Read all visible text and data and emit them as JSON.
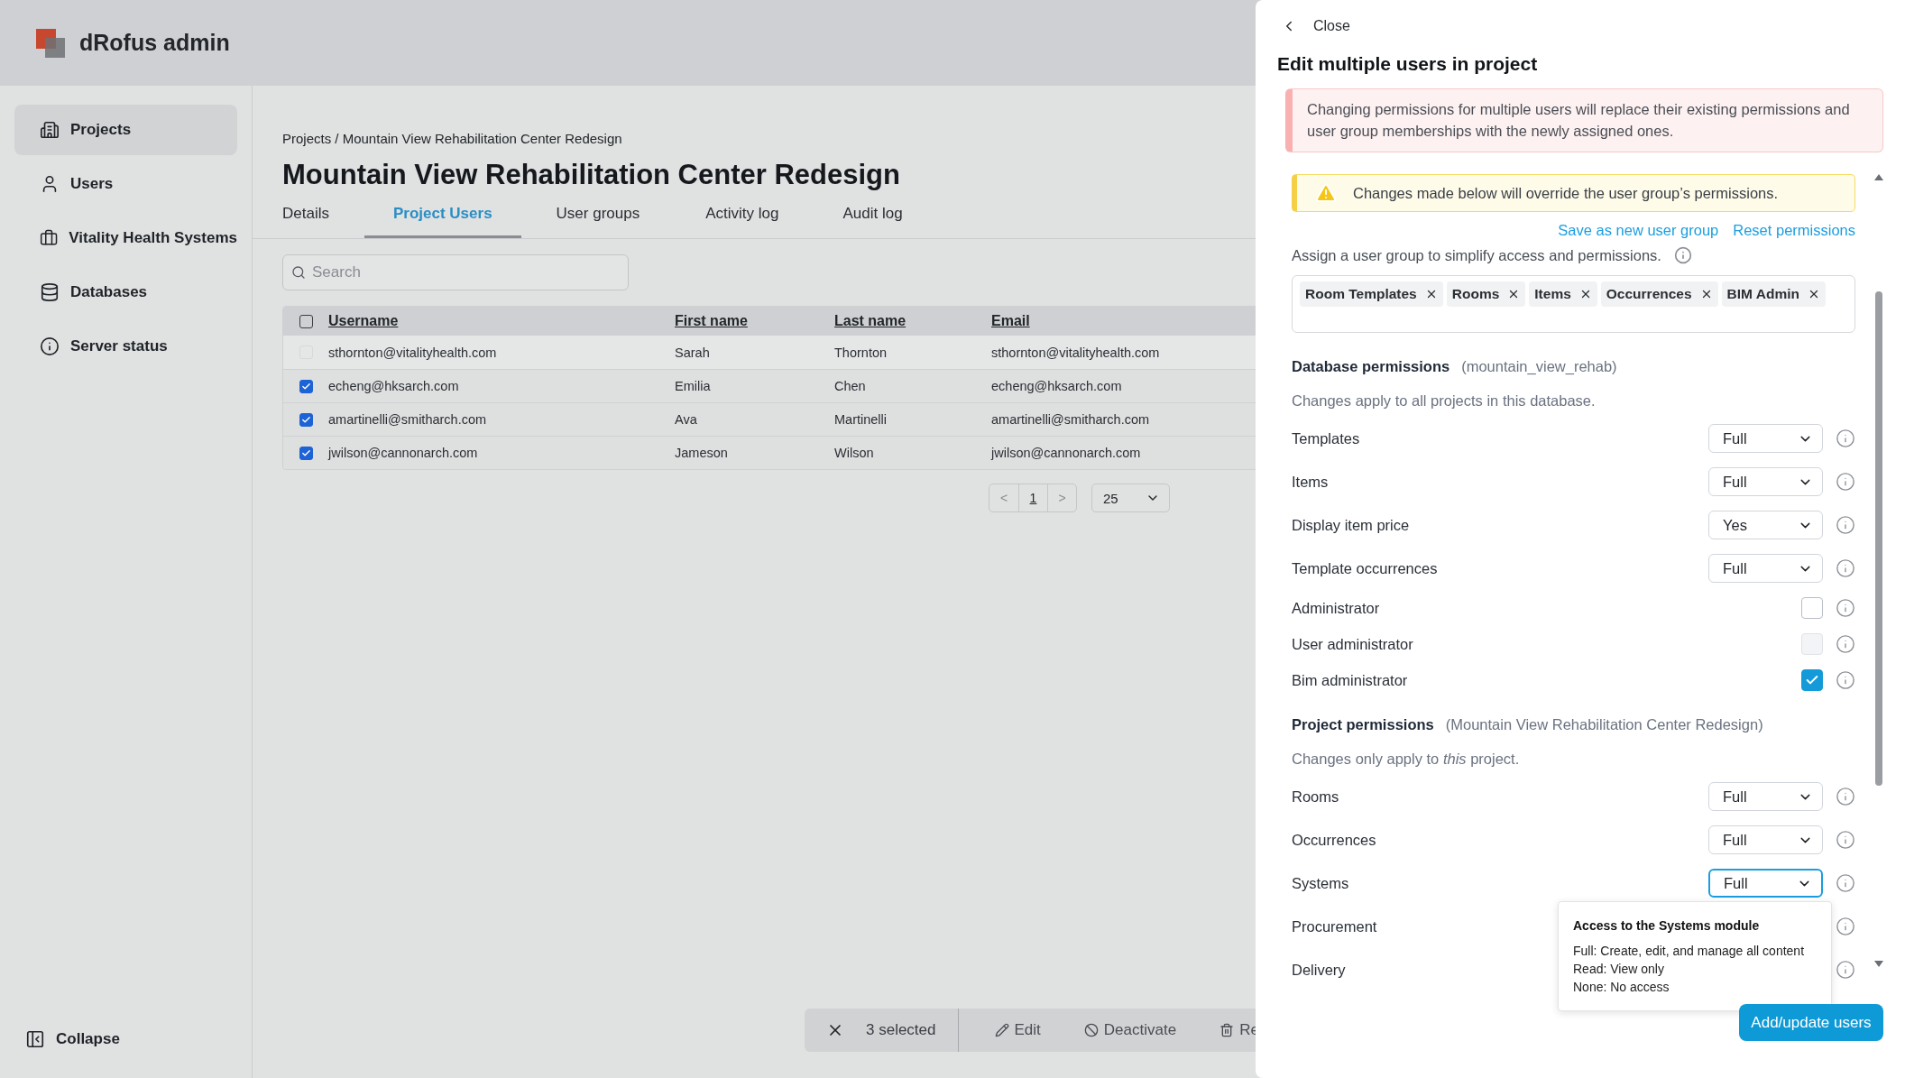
{
  "app": {
    "title": "dRofus admin"
  },
  "sidebar": {
    "items": [
      {
        "label": "Projects",
        "selected": true
      },
      {
        "label": "Users",
        "selected": false
      },
      {
        "label": "Vitality Health Systems",
        "selected": false
      },
      {
        "label": "Databases",
        "selected": false
      },
      {
        "label": "Server status",
        "selected": false
      }
    ],
    "collapse": "Collapse"
  },
  "main": {
    "breadcrumb": "Projects / Mountain View Rehabilitation Center Redesign",
    "title": "Mountain View Rehabilitation Center Redesign",
    "tabs": [
      {
        "label": "Details",
        "selected": false
      },
      {
        "label": "Project Users",
        "selected": true
      },
      {
        "label": "User groups",
        "selected": false
      },
      {
        "label": "Activity log",
        "selected": false
      },
      {
        "label": "Audit log",
        "selected": false
      }
    ],
    "search": {
      "placeholder": "Search"
    },
    "table": {
      "header_checked": false,
      "columns": [
        "Username",
        "First name",
        "Last name",
        "Email"
      ],
      "rows": [
        {
          "cells": [
            "sthornton@vitalityhealth.com",
            "Sarah",
            "Thornton",
            "sthornton@vitalityhealth.com"
          ],
          "checked": false,
          "disabled": true
        },
        {
          "cells": [
            "echeng@hksarch.com",
            "Emilia",
            "Chen",
            "echeng@hksarch.com"
          ],
          "checked": true,
          "disabled": false
        },
        {
          "cells": [
            "amartinelli@smitharch.com",
            "Ava",
            "Martinelli",
            "amartinelli@smitharch.com"
          ],
          "checked": true,
          "disabled": false
        },
        {
          "cells": [
            "jwilson@cannonarch.com",
            "Jameson",
            "Wilson",
            "jwilson@cannonarch.com"
          ],
          "checked": true,
          "disabled": false
        }
      ]
    },
    "pagination": {
      "prev": "<",
      "page": "1",
      "next": ">",
      "page_size": "25"
    },
    "selection_bar": {
      "count": "3 selected",
      "actions": [
        "Edit",
        "Deactivate",
        "Re"
      ]
    }
  },
  "drawer": {
    "close": "Close",
    "title": "Edit multiple users in project",
    "alert": "Changing permissions for multiple users will replace their existing permissions and user group memberships with the newly assigned ones.",
    "warning": "Changes made below will override the user group’s permissions.",
    "links": [
      "Save as new user group",
      "Reset permissions"
    ],
    "assign_hint": "Assign a user group to simplify access and permissions.",
    "tags": [
      "Room Templates",
      "Rooms",
      "Items",
      "Occurrences",
      "BIM Admin"
    ],
    "sections": [
      {
        "title": "Database permissions",
        "scope": "(mountain_view_rehab)",
        "note": "Changes apply to all projects in this database.",
        "rows": [
          {
            "label": "Templates",
            "kind": "select",
            "value": "Full",
            "focused": false
          },
          {
            "label": "Items",
            "kind": "select",
            "value": "Full",
            "focused": false
          },
          {
            "label": "Display item price",
            "kind": "select",
            "value": "Yes",
            "focused": false
          },
          {
            "label": "Template occurrences",
            "kind": "select",
            "value": "Full",
            "focused": false
          },
          {
            "label": "Administrator",
            "kind": "checkbox",
            "checked": false,
            "disabled": false
          },
          {
            "label": "User administrator",
            "kind": "checkbox",
            "checked": false,
            "disabled": true
          },
          {
            "label": "Bim administrator",
            "kind": "checkbox",
            "checked": true,
            "disabled": false
          }
        ]
      },
      {
        "title": "Project permissions",
        "scope": "(Mountain View Rehabilitation Center Redesign)",
        "note": "Changes only apply to *this* project.",
        "rows": [
          {
            "label": "Rooms",
            "kind": "select",
            "value": "Full",
            "focused": false
          },
          {
            "label": "Occurrences",
            "kind": "select",
            "value": "Full",
            "focused": false
          },
          {
            "label": "Systems",
            "kind": "select",
            "value": "Full",
            "focused": true
          },
          {
            "label": "Procurement",
            "kind": "covered"
          },
          {
            "label": "Delivery",
            "kind": "covered"
          }
        ]
      }
    ],
    "tooltip": {
      "title": "Access to the Systems module",
      "lines": [
        "Full: Create, edit, and manage all content",
        "Read: View only",
        "None: No access"
      ]
    },
    "submit": "Add/update users"
  }
}
